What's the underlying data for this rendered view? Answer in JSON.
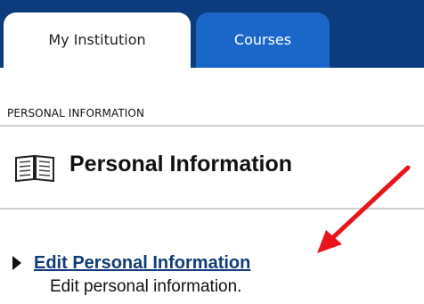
{
  "tabs": [
    {
      "label": "My Institution",
      "active": true
    },
    {
      "label": "Courses",
      "active": false
    }
  ],
  "section": {
    "label": "PERSONAL INFORMATION"
  },
  "page": {
    "title": "Personal Information",
    "icon": "book-icon"
  },
  "link": {
    "label": "Edit Personal Information",
    "description": "Edit personal information.",
    "icon": "caret-right-icon"
  },
  "annotation": {
    "icon": "red-arrow-icon",
    "color": "#e8141b"
  },
  "colors": {
    "navbar": "#0c3c7e",
    "tab_inactive": "#1b67c9",
    "link": "#113c7a"
  }
}
